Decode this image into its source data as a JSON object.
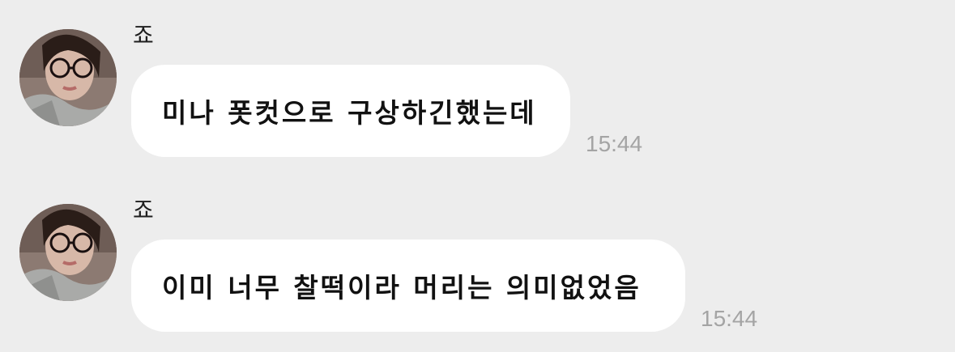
{
  "messages": [
    {
      "sender": "죠",
      "text": "미나 폿컷으로 구상하긴했는데",
      "time": "15:44",
      "avatar_icon": "profile-photo-woman-glasses"
    },
    {
      "sender": "죠",
      "text": "이미 너무 찰떡이라 머리는 의미없었음",
      "time": "15:44",
      "avatar_icon": "profile-photo-woman-glasses"
    }
  ],
  "colors": {
    "background": "#ededed",
    "bubble": "#ffffff",
    "text": "#111111",
    "timestamp": "#a4a4a4"
  }
}
